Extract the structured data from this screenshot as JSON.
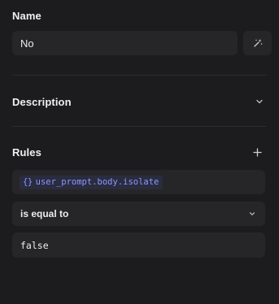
{
  "name_section": {
    "label": "Name",
    "value": "No",
    "magic_icon": "sparkle-wand-icon"
  },
  "description_section": {
    "label": "Description",
    "toggle_icon": "chevron-down-icon"
  },
  "rules_section": {
    "label": "Rules",
    "add_icon": "plus-icon",
    "variable": {
      "icon": "curly-braces-icon",
      "icon_glyph": "{}",
      "path": "user_prompt.body.isolate"
    },
    "operator": {
      "label": "is equal to",
      "dropdown_icon": "chevron-down-icon"
    },
    "value": "false"
  },
  "colors": {
    "background": "#1c1c1e",
    "field": "#262628",
    "variable_chip_bg": "#2a2c3f",
    "variable_chip_text": "#8e98ff"
  }
}
